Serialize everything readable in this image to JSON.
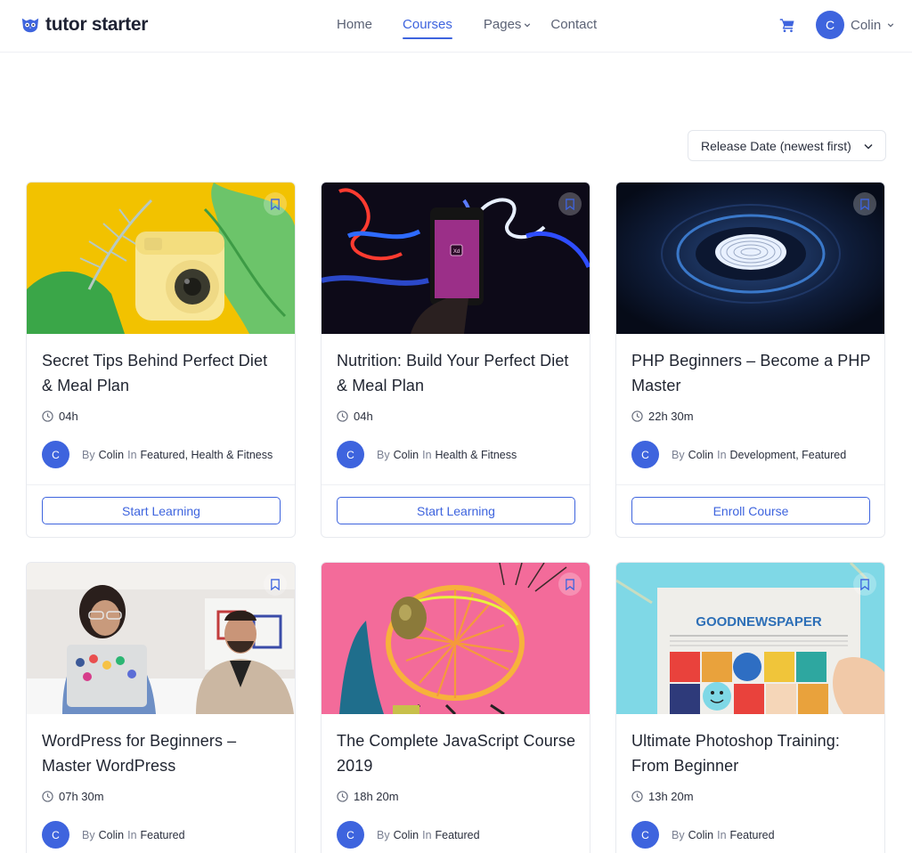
{
  "header": {
    "logo_text": "tutor starter",
    "nav": [
      {
        "label": "Home"
      },
      {
        "label": "Courses"
      },
      {
        "label": "Pages"
      },
      {
        "label": "Contact"
      }
    ],
    "user": {
      "initial": "C",
      "name": "Colin"
    },
    "accent": "#3e64de"
  },
  "sort": {
    "selected": "Release Date (newest first)"
  },
  "courses": [
    {
      "title": "Secret Tips Behind Perfect Diet & Meal Plan",
      "duration": "04h",
      "by": "By",
      "author": "Colin",
      "in": "In",
      "cats": [
        "Featured",
        "Health & Fitness"
      ],
      "button": "Start Learning",
      "avatar": "C",
      "thumb": "yellow-camera-leaves"
    },
    {
      "title": "Nutrition: Build Your Perfect Diet & Meal Plan",
      "duration": "04h",
      "by": "By",
      "author": "Colin",
      "in": "In",
      "cats": [
        "Health & Fitness"
      ],
      "button": "Start Learning",
      "avatar": "C",
      "thumb": "neon-phone-xd"
    },
    {
      "title": "PHP Beginners – Become a PHP Master",
      "duration": "22h 30m",
      "by": "By",
      "author": "Colin",
      "in": "In",
      "cats": [
        "Development",
        "Featured"
      ],
      "button": "Enroll Course",
      "avatar": "C",
      "thumb": "fingerprint-scanner"
    },
    {
      "title": "WordPress for Beginners – Master WordPress",
      "duration": "07h 30m",
      "by": "By",
      "author": "Colin",
      "in": "In",
      "cats": [
        "Featured"
      ],
      "button": "",
      "avatar": "C",
      "thumb": "people-laptop"
    },
    {
      "title": "The Complete JavaScript Course 2019",
      "duration": "18h 20m",
      "by": "By",
      "author": "Colin",
      "in": "In",
      "cats": [
        "Featured"
      ],
      "button": "",
      "avatar": "C",
      "thumb": "pink-chair-coconut"
    },
    {
      "title": "Ultimate Photoshop Training: From Beginner",
      "duration": "13h 20m",
      "by": "By",
      "author": "Colin",
      "in": "In",
      "cats": [
        "Featured"
      ],
      "button": "",
      "avatar": "C",
      "thumb": "good-newspaper"
    }
  ],
  "newspaper_masthead": "GOODNEWSPAPER",
  "phone_label": "Xd"
}
